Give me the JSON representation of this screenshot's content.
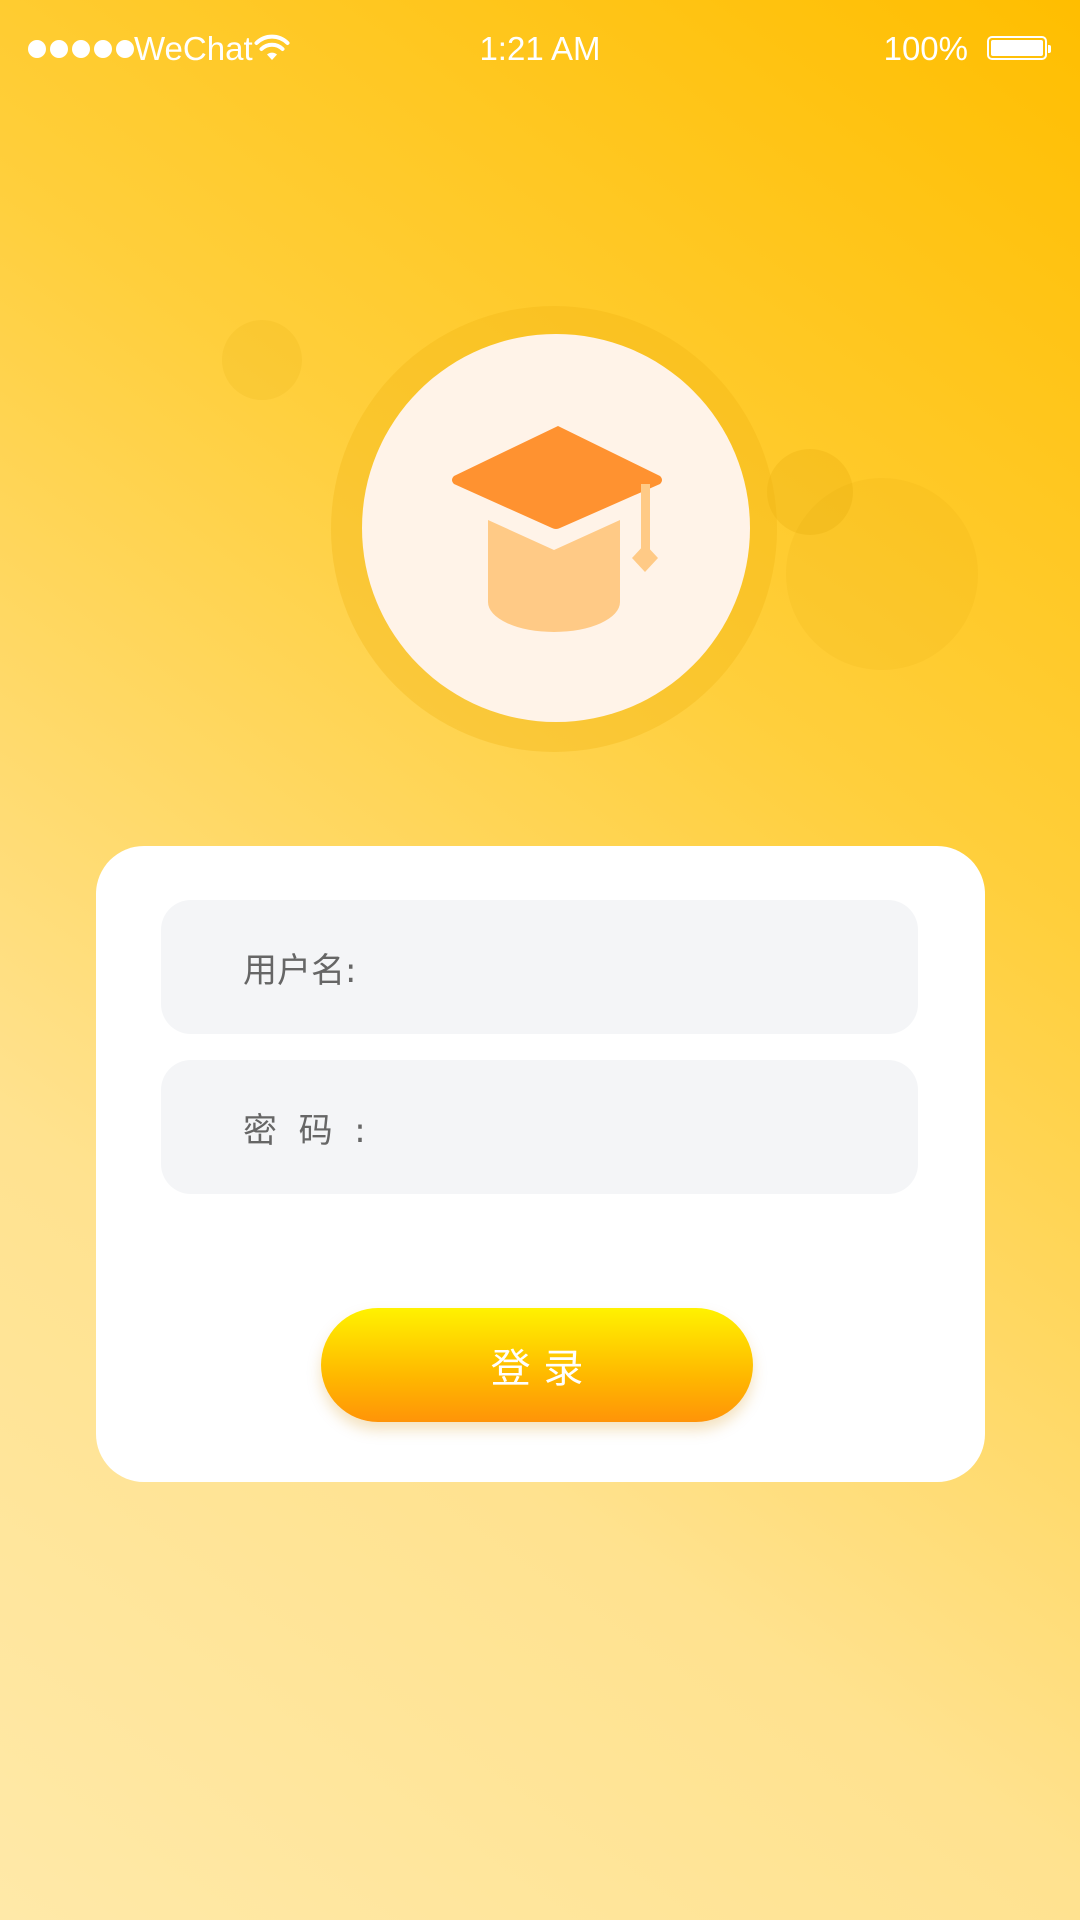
{
  "status_bar": {
    "carrier": "WeChat",
    "time": "1:21 AM",
    "battery_percent": "100%",
    "battery_level": 1.0,
    "signal_icon": "signal-dots-icon",
    "wifi_icon": "wifi-icon",
    "battery_icon": "battery-icon"
  },
  "logo": {
    "icon": "graduation-cap-icon"
  },
  "login_form": {
    "username_label": "用户名:",
    "username_value": "",
    "password_label": "密  码  :",
    "password_value": "",
    "submit_label": "登 录"
  },
  "colors": {
    "background_top": "#ffbe00",
    "background_bottom": "#ffe9a8",
    "logo_cap": "#ff9230",
    "logo_body": "#ffca86",
    "button_top": "#fff200",
    "button_bottom": "#ff9408",
    "field_background": "#f4f5f7"
  }
}
